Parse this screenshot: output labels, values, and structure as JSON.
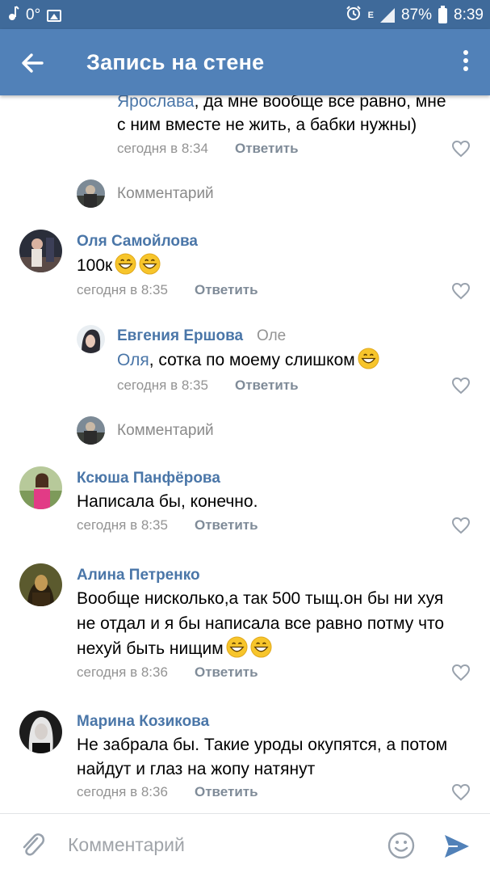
{
  "status_bar": {
    "temperature": "0°",
    "battery_percent": "87%",
    "time": "8:39",
    "network": "E"
  },
  "header": {
    "title": "Запись на стене"
  },
  "comments": [
    {
      "mention": "Ярослава",
      "text_line1_rest": ", да мне вообще все равно, мне",
      "text_line2": "с ним вместе не жить, а бабки нужны)",
      "date": "сегодня в 8:34",
      "reply_label": "Ответить"
    },
    {
      "name": "Оля Самойлова",
      "text": "100к",
      "date": "сегодня в 8:35",
      "reply_label": "Ответить"
    },
    {
      "name": "Евгения Ершова",
      "reply_to": "Оле",
      "mention": "Оля",
      "text_rest": ", сотка по моему слишком",
      "date": "сегодня в 8:35",
      "reply_label": "Ответить"
    },
    {
      "name": "Ксюша Панфёрова",
      "text": "Написала бы, конечно.",
      "date": "сегодня в 8:35",
      "reply_label": "Ответить"
    },
    {
      "name": "Алина Петренко",
      "text_line1": "Вообще нисколько,а так 500 тыщ.он бы ни хуя",
      "text_line2": "не отдал и я бы написала все равно потму что",
      "text_line3": "нехуй быть нищим",
      "date": "сегодня в 8:36",
      "reply_label": "Ответить"
    },
    {
      "name": "Марина Козикова",
      "text_line1": "Не забрала бы. Такие уроды окупятся, а потом",
      "text_line2": "найдут и глаз на жопу натянут",
      "date": "сегодня в 8:36",
      "reply_label": "Ответить"
    }
  ],
  "add_comment_label": "Комментарий",
  "composer": {
    "placeholder": "Комментарий"
  },
  "colors": {
    "status_bar": "#3f6a9a",
    "app_bar": "#5181b8",
    "name_link": "#4a76a8",
    "meta_gray": "#939393"
  }
}
